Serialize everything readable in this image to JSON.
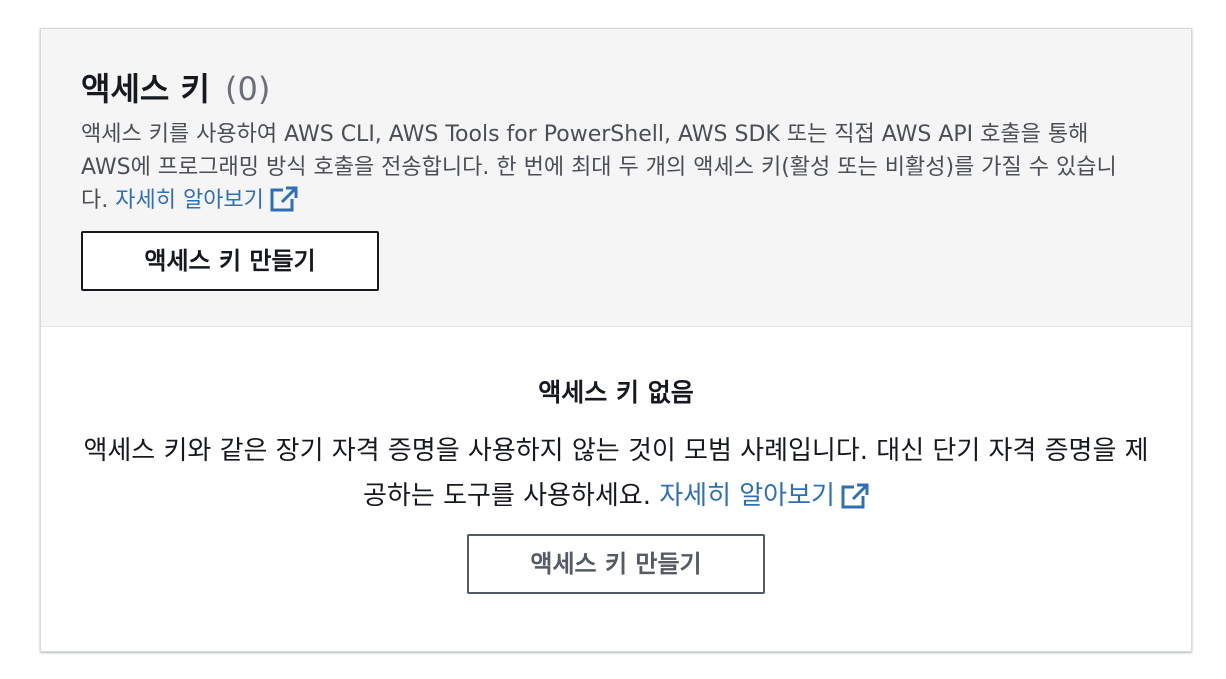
{
  "header": {
    "title": "액세스 키",
    "count": "(0)",
    "description": "액세스 키를 사용하여 AWS CLI, AWS Tools for PowerShell, AWS SDK 또는 직접 AWS API 호출을 통해 AWS에 프로그래밍 방식 호출을 전송합니다. 한 번에 최대 두 개의 액세스 키(활성 또는 비활성)를 가질 수 있습니다.",
    "learn_more": "자세히 알아보기",
    "create_button": "액세스 키 만들기"
  },
  "empty_state": {
    "title": "액세스 키 없음",
    "description": "액세스 키와 같은 장기 자격 증명을 사용하지 않는 것이 모범 사례입니다. 대신 단기 자격 증명을 제공하는 도구를 사용하세요.",
    "learn_more": "자세히 알아보기",
    "create_button": "액세스 키 만들기"
  },
  "icons": {
    "external_link": "external-link-icon"
  },
  "colors": {
    "link": "#2f6fb7",
    "header_background": "#f5f5f5",
    "text": "#16191f",
    "muted_text": "#6b6f75"
  }
}
